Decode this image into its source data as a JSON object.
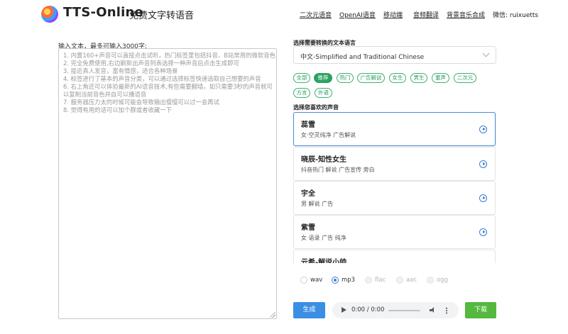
{
  "header": {
    "brand": "TTS-Online",
    "subtitle": "免费文字转语音",
    "nav": [
      "二次元语音",
      "OpenAI语音",
      "移动端",
      "音频翻译",
      "背景音乐合成"
    ],
    "wechat": "微信: ruixuetts"
  },
  "input": {
    "label": "输入文本，最多可输入3000字:",
    "placeholder_lines": [
      "1. 内置160+声音可以直接点击试听，热门标签里包括抖音、B站常用的微软音色",
      "2. 完全免费使用,右边刷新出声音列表选择一种声音后点击生成即可",
      "3. 接近真人发音，富有情感，适合各种场景",
      "4. 标签进行了基本的声音分类，可以通过选择标签快速选取自己想要的声音",
      "6. 右上角还可以体验最新的AI语音技术,有些需要翻墙，如只需要3秒的声音就可",
      "以复制当前音色并自可以播语音",
      "7. 服务器压力太的时候可能会导致输出慢慢可以过一会再试",
      "8. 觉得有用的话可以加个群或者收藏一下"
    ]
  },
  "language": {
    "title": "选择需要转换的文本语言",
    "selected": "中文-Simplified and Traditional Chinese"
  },
  "tags": {
    "items": [
      "全部",
      "推荐",
      "热门",
      "广告解说",
      "女生",
      "男生",
      "童声",
      "二次元",
      "方言",
      "外语"
    ],
    "active": "推荐"
  },
  "voices": {
    "title": "选择您喜欢的声音",
    "items": [
      {
        "name": "蕊雪",
        "tags": "女·空灵纯净 广告解说"
      },
      {
        "name": "晓辰-知性女生",
        "tags": "抖音热门 解说 广告宣传 旁白"
      },
      {
        "name": "宇全",
        "tags": "男 解说 广告"
      },
      {
        "name": "紫雪",
        "tags": "女 语录 广告 纯净"
      },
      {
        "name": "云希-解说小帅",
        "tags": ""
      }
    ]
  },
  "formats": {
    "options": [
      "wav",
      "mp3",
      "flac",
      "aac",
      "ogg"
    ],
    "selected": "mp3"
  },
  "actions": {
    "generate": "生成",
    "download": "下载"
  },
  "audio": {
    "time": "0:00 / 0:00"
  }
}
